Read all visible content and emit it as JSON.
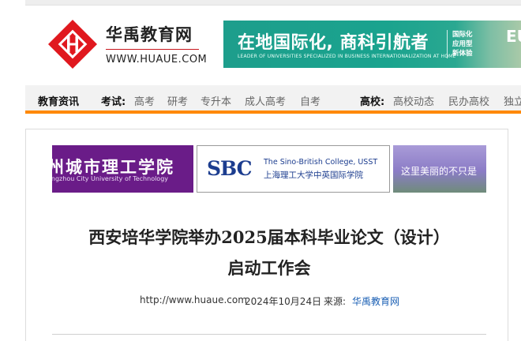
{
  "header": {
    "brand_name": "华禹教育网",
    "brand_url": "WWW.HUAUE.COM",
    "banner": {
      "title": "在地国际化, 商科引航者",
      "subtitle": "LEADER OF UNIVERSITIES SPECIALIZED IN BUSINESS INTERNATIONALIZATION AT HOME",
      "side_lines": [
        "国际化",
        "应用型",
        "新体验"
      ],
      "corner_text": "EU"
    }
  },
  "nav": {
    "section_label": "教育资讯",
    "exam_label": "考试:",
    "exam_items": [
      "高考",
      "研考",
      "专升本",
      "成人高考",
      "自考"
    ],
    "school_label": "高校:",
    "school_items": [
      "高校动态",
      "民办高校",
      "独立"
    ]
  },
  "ads": [
    {
      "cn": "州城市理工学院",
      "en": "angzhou City University of Technology"
    },
    {
      "logo": "SBC",
      "en": "The Sino-British College, USST",
      "cn": "上海理工大学中英国际学院"
    },
    {
      "text": "这里美丽的不只是"
    }
  ],
  "article": {
    "title_line1": "西安培华学院举办2025届本科毕业论文（设计）",
    "title_line2": "启动工作会",
    "meta": {
      "site": "http://www.huaue.com",
      "date": "2024年10月24日",
      "source_label": "来源:",
      "source": "华禹教育网"
    }
  },
  "colors": {
    "brand_red": "#c8161d",
    "nav_accent": "#ff8800",
    "banner_teal": "#1d9e8c",
    "link_blue": "#1a5fb4"
  }
}
